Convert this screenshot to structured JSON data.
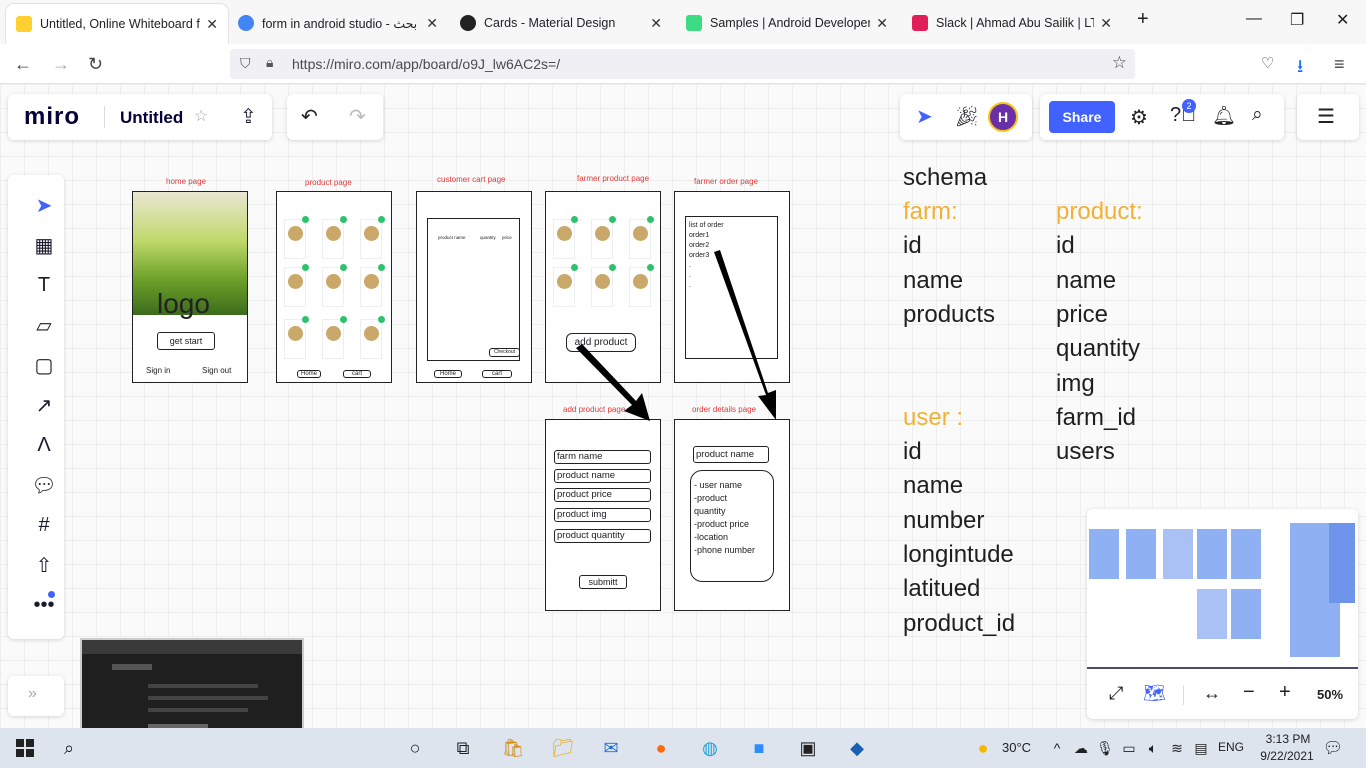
{
  "browser": {
    "tabs": [
      {
        "title": "Untitled, Online Whiteboard for",
        "fav_color": "#ffd02f",
        "active": true
      },
      {
        "title": "form in android studio - بحث Go",
        "fav_color": "#4285f4",
        "active": false
      },
      {
        "title": "Cards - Material Design",
        "fav_color": "#222222",
        "active": false
      },
      {
        "title": "Samples | Android Developers",
        "fav_color": "#3ddc84",
        "active": false
      },
      {
        "title": "Slack | Ahmad Abu Sailik | LTUC",
        "fav_color": "#e01e5a",
        "active": false
      }
    ],
    "url": "https://miro.com/app/board/o9J_lw6AC2s=/"
  },
  "miro": {
    "logo": "miro",
    "board_title": "Untitled",
    "share_label": "Share",
    "avatar_initial": "H",
    "help_badge": "2",
    "zoom": "50%"
  },
  "frames": {
    "home": {
      "label": "home  page",
      "logo": "logo",
      "button": "get start",
      "sign_in": "Sign in",
      "sign_out": "Sign out"
    },
    "product": {
      "label": "product page",
      "btn1": "Home",
      "btn2": "cart"
    },
    "cart": {
      "label": "customer cart page",
      "col1": "product name",
      "col2": "quantity",
      "col3": "price",
      "checkout": "Checkout",
      "btn1": "Home",
      "btn2": "cart"
    },
    "farmer_product": {
      "label": "farmer  product  page",
      "add_button": "add product"
    },
    "farmer_order": {
      "label": "farmer order   page",
      "lines": [
        "list of order",
        "order1",
        "order2",
        "order3",
        ".",
        ".",
        "."
      ]
    },
    "add_product": {
      "label": "add product page",
      "fields": [
        "farm name",
        "product name",
        "product price",
        "product img",
        "product quantity"
      ],
      "submit": "submitt"
    },
    "order_details": {
      "label": "order details  page",
      "title_field": "product name",
      "lines": [
        "- user name",
        "-product",
        "quantity",
        "-product price",
        "-location",
        "-phone number"
      ]
    }
  },
  "schema": {
    "title": "schema",
    "farm_head": "farm:",
    "farm_fields": [
      "id",
      "name",
      "products"
    ],
    "product_head": "product:",
    "product_fields": [
      "id",
      "name",
      "price",
      "quantity",
      "img",
      "farm_id",
      "users"
    ],
    "user_head": "user :",
    "user_fields": [
      "id",
      "name",
      "number",
      "longintude",
      "latitued",
      "product_id"
    ]
  },
  "taskbar": {
    "temperature": "30°C",
    "language": "ENG",
    "time": "3:13 PM",
    "date": "9/22/2021"
  },
  "colors": {
    "accent": "#4262ff",
    "schema_heading": "#f2b134",
    "frame_label": "#e03a3a"
  }
}
